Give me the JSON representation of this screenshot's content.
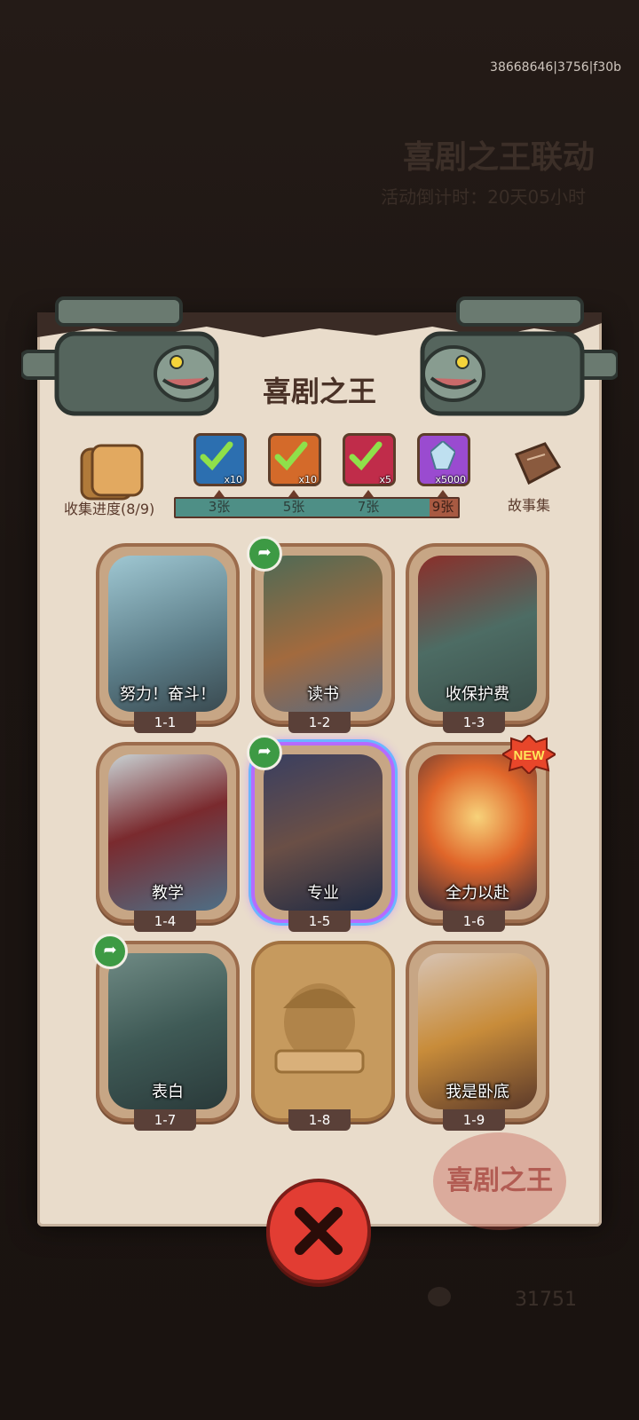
{
  "background": {
    "id_text": "38668646|3756|f30b",
    "subtitle": "",
    "event_title": "喜剧之王联动",
    "timer": "活动倒计时：20天05小时",
    "score": "31751"
  },
  "panel": {
    "title": "喜剧之王",
    "collect_label": "收集进度(8/9)",
    "story_label": "故事集",
    "progress_fraction": 0.9,
    "milestones": [
      "3张",
      "5张",
      "7张",
      "9张"
    ],
    "rewards": [
      {
        "icon": "green-book-icon",
        "count": "x10",
        "claimed": true,
        "color": "#2c6fb0"
      },
      {
        "icon": "orange-book-icon",
        "count": "x10",
        "claimed": true,
        "color": "#d46a2a"
      },
      {
        "icon": "purple-orb-icon",
        "count": "x5",
        "claimed": true,
        "color": "#c02c4a"
      },
      {
        "icon": "crystal-icon",
        "count": "x5000",
        "claimed": false,
        "color": "#9a4bd0"
      }
    ]
  },
  "cards": [
    {
      "label": "努力！奋斗！",
      "number": "1-1"
    },
    {
      "label": "读书",
      "number": "1-2"
    },
    {
      "label": "收保护费",
      "number": "1-3"
    },
    {
      "label": "教学",
      "number": "1-4"
    },
    {
      "label": "专业",
      "number": "1-5"
    },
    {
      "label": "全力以赴",
      "number": "1-6"
    },
    {
      "label": "表白",
      "number": "1-7"
    },
    {
      "label": "",
      "number": "1-8"
    },
    {
      "label": "我是卧底",
      "number": "1-9"
    }
  ],
  "seal_text": "喜剧之王",
  "new_badge": "NEW",
  "colors": {
    "accent_red": "#e23d33",
    "progress_teal": "#4e8f86",
    "share_green": "#3d9a44"
  }
}
